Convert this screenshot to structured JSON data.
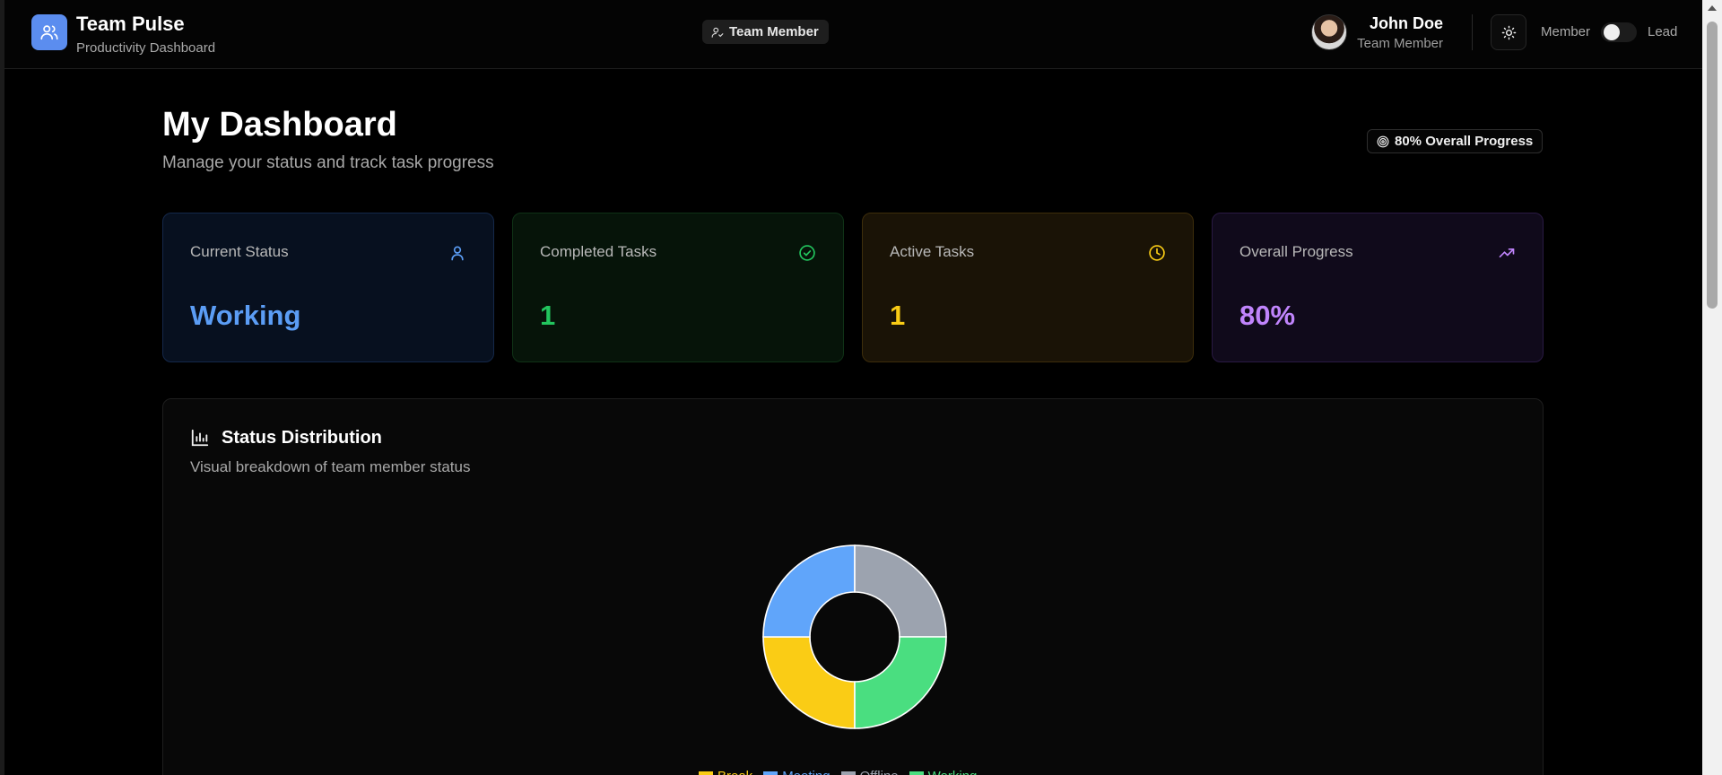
{
  "header": {
    "app_title": "Team Pulse",
    "app_subtitle": "Productivity Dashboard",
    "role_pill": "Team Member",
    "user": {
      "name": "John Doe",
      "role": "Team Member"
    },
    "mode_member": "Member",
    "mode_lead": "Lead"
  },
  "main": {
    "title": "My Dashboard",
    "subtitle": "Manage your status and track task progress",
    "progress_badge": "80% Overall Progress"
  },
  "stats": [
    {
      "label": "Current Status",
      "value": "Working",
      "icon": "user-icon",
      "color": "#5b9df5"
    },
    {
      "label": "Completed Tasks",
      "value": "1",
      "icon": "check-circle-icon",
      "color": "#22c55e"
    },
    {
      "label": "Active Tasks",
      "value": "1",
      "icon": "clock-icon",
      "color": "#facc15"
    },
    {
      "label": "Overall Progress",
      "value": "80%",
      "icon": "trending-up-icon",
      "color": "#c084fc"
    }
  ],
  "status_panel": {
    "title": "Status Distribution",
    "subtitle": "Visual breakdown of team member status"
  },
  "chart_data": {
    "type": "pie",
    "categories": [
      "Break",
      "Meeting",
      "Offline",
      "Working"
    ],
    "values": [
      1,
      1,
      1,
      1
    ],
    "colors": [
      "#facc15",
      "#60a5fa",
      "#9ca3af",
      "#4ade80"
    ],
    "legend_position": "bottom"
  }
}
